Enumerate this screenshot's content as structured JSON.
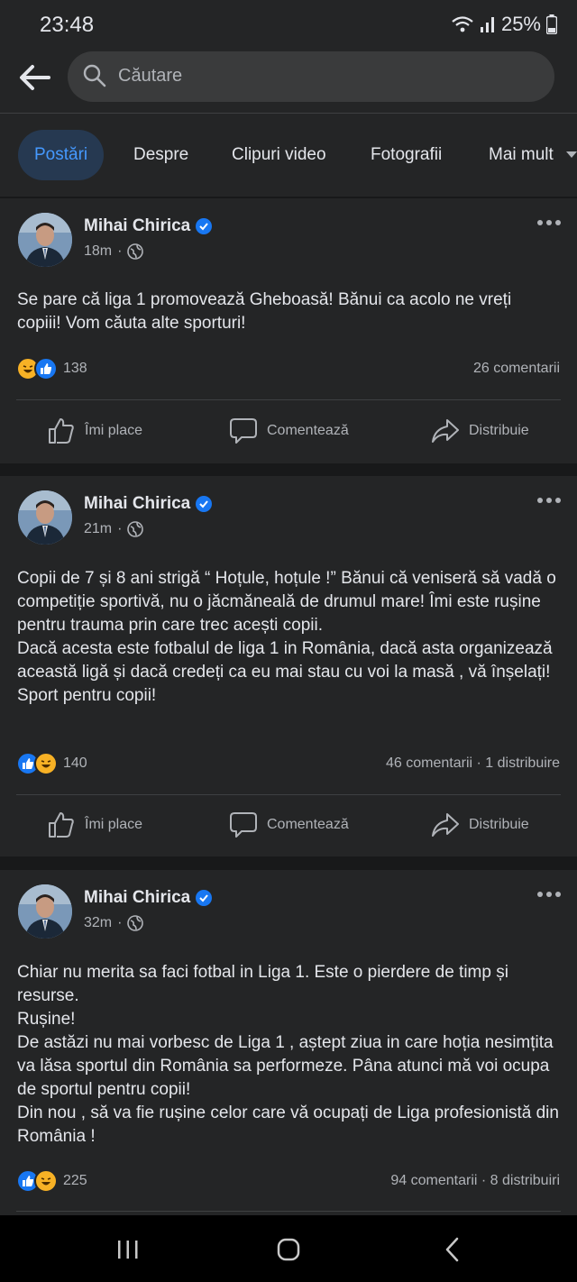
{
  "status": {
    "time": "23:48",
    "battery": "25%"
  },
  "search": {
    "placeholder": "Căutare"
  },
  "tabs": [
    {
      "label": "Postări"
    },
    {
      "label": "Despre"
    },
    {
      "label": "Clipuri video"
    },
    {
      "label": "Fotografii"
    },
    {
      "label": "Mai mult"
    }
  ],
  "posts": [
    {
      "author": "Mihai Chirica",
      "time": "18m",
      "text": "Se pare că liga 1 promovează Gheboasă! Bănui ca acolo ne vreți copiii! Vom căuta alte sporturi!",
      "reaction_count": "138",
      "comments": "26 comentarii"
    },
    {
      "author": "Mihai Chirica",
      "time": "21m",
      "text": "Copii de 7 și 8 ani strigă “ Hoțule, hoțule !” Bănui că veniseră să vadă o competiție sportivă, nu o jăcmăneală de drumul mare! Îmi este rușine pentru trauma prin care trec acești copii.\nDacă acesta este fotbalul de liga 1 in România, dacă asta organizează această ligă și dacă credeți ca eu mai stau cu voi la masă , vă înșelați!\nSport pentru copii!",
      "reaction_count": "140",
      "comments": "46 comentarii · 1 distribuire"
    },
    {
      "author": "Mihai Chirica",
      "time": "32m",
      "text": "Chiar nu merita sa faci fotbal in  Liga 1. Este o pierdere de timp și resurse.\nRușine!\nDe astăzi nu mai vorbesc de Liga 1 , aștept ziua in care hoția nesimțita va lăsa sportul din România sa performeze. Pâna atunci mă voi ocupa de sportul pentru copii!\nDin nou , să va fie rușine celor care vă ocupați de Liga profesionistă din România !",
      "reaction_count": "225",
      "comments": "94 comentarii · 8 distribuiri"
    }
  ],
  "actions": {
    "like": "Îmi place",
    "comment": "Comentează",
    "share": "Distribuie"
  },
  "colors": {
    "background": "#18191a",
    "card": "#242526",
    "accent": "#4599ff",
    "verified": "#1877f2",
    "like": "#1877f2",
    "haha": "#f7b125"
  },
  "icons": [
    "back-arrow-icon",
    "search-icon",
    "verified-badge-icon",
    "globe-icon",
    "more-dots-icon",
    "haha-reaction-icon",
    "like-reaction-icon",
    "thumbs-up-icon",
    "comment-bubble-icon",
    "share-arrow-icon",
    "recents-icon",
    "home-icon",
    "back-nav-icon"
  ]
}
